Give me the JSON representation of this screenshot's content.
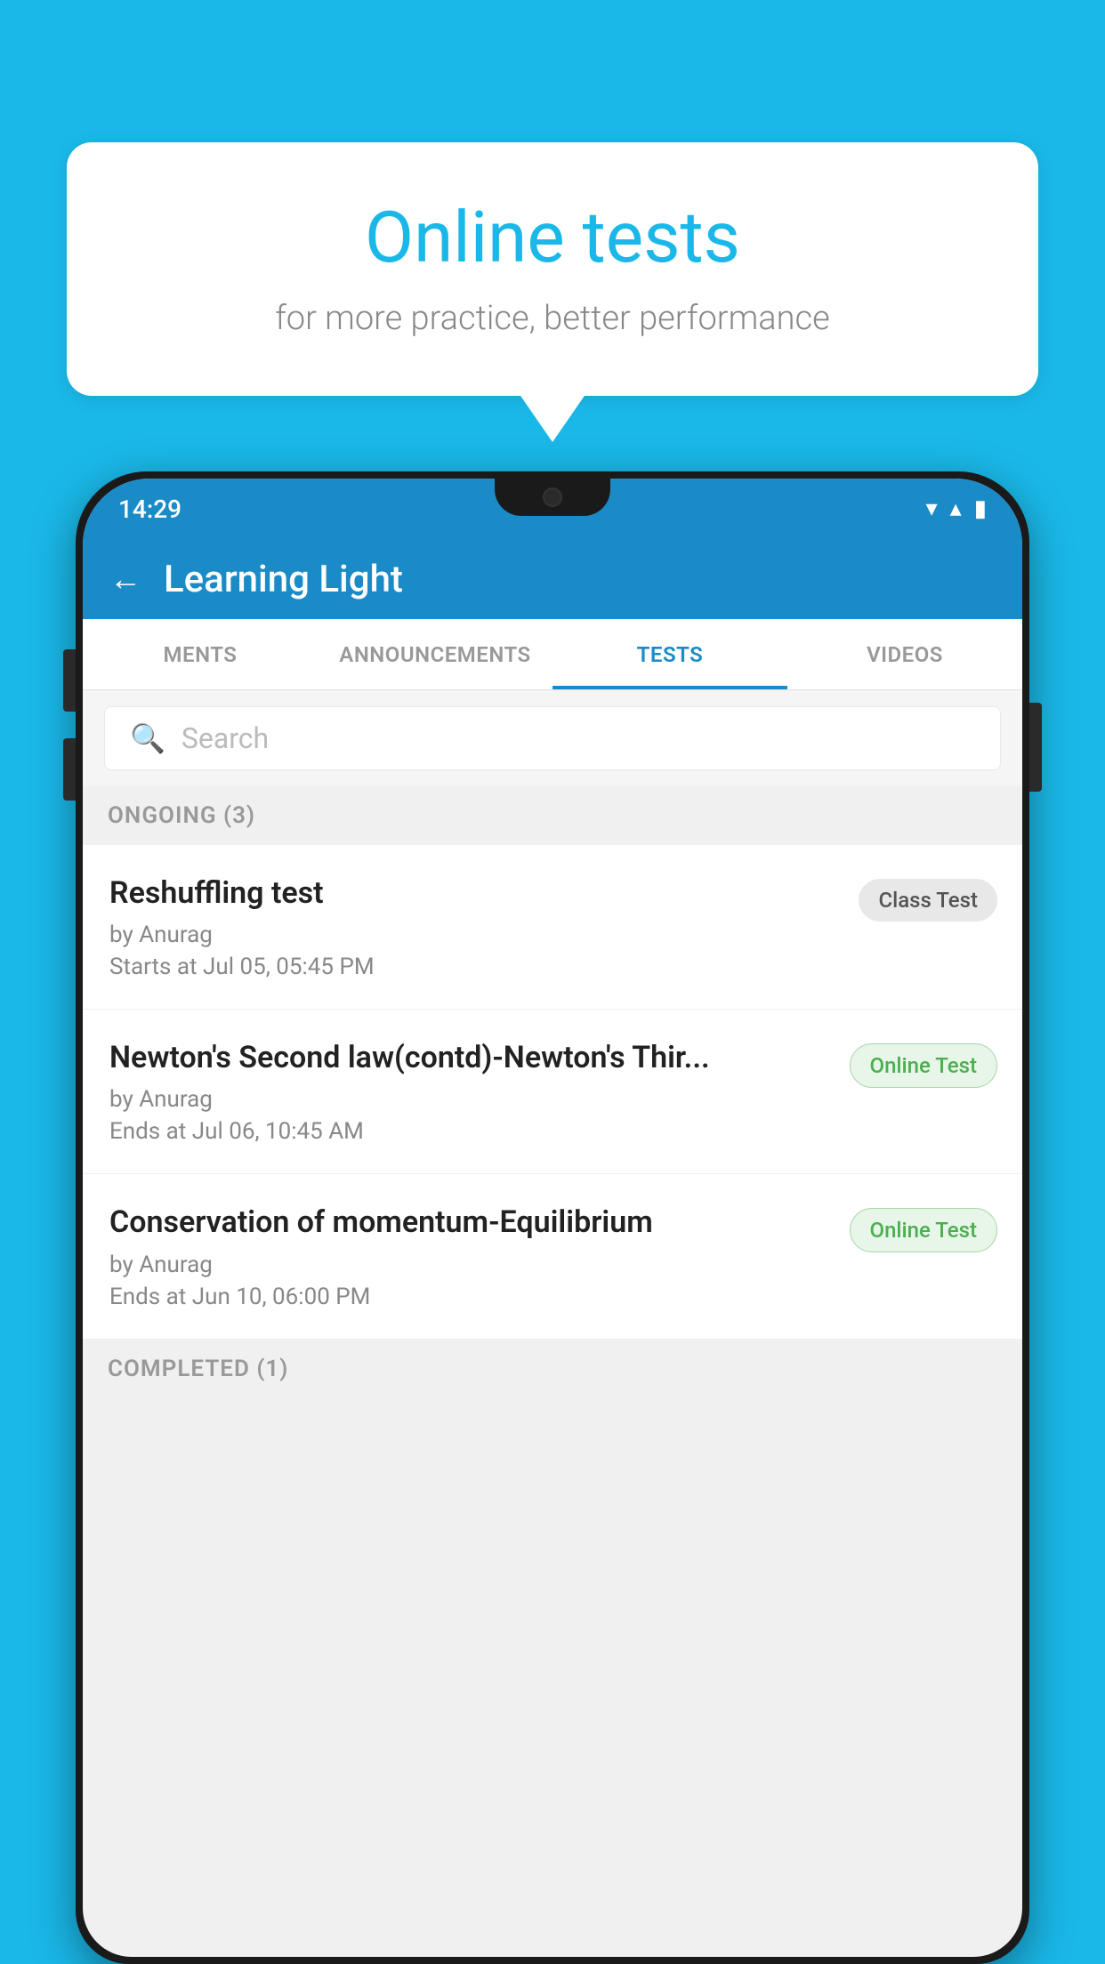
{
  "background": {
    "color": "#1ab8e8"
  },
  "speech_bubble": {
    "title": "Online tests",
    "subtitle": "for more practice, better performance"
  },
  "status_bar": {
    "time": "14:29",
    "wifi_icon": "▼",
    "signal_icon": "▲",
    "battery_icon": "▮"
  },
  "app_header": {
    "back_label": "←",
    "title": "Learning Light"
  },
  "tabs": [
    {
      "label": "MENTS",
      "active": false
    },
    {
      "label": "ANNOUNCEMENTS",
      "active": false
    },
    {
      "label": "TESTS",
      "active": true
    },
    {
      "label": "VIDEOS",
      "active": false
    }
  ],
  "search": {
    "placeholder": "Search"
  },
  "ongoing_section": {
    "label": "ONGOING (3)"
  },
  "tests": [
    {
      "name": "Reshuffling test",
      "author": "by Anurag",
      "time_label": "Starts at",
      "time": "Jul 05, 05:45 PM",
      "badge": "Class Test",
      "badge_type": "class"
    },
    {
      "name": "Newton's Second law(contd)-Newton's Thir...",
      "author": "by Anurag",
      "time_label": "Ends at",
      "time": "Jul 06, 10:45 AM",
      "badge": "Online Test",
      "badge_type": "online"
    },
    {
      "name": "Conservation of momentum-Equilibrium",
      "author": "by Anurag",
      "time_label": "Ends at",
      "time": "Jun 10, 06:00 PM",
      "badge": "Online Test",
      "badge_type": "online"
    }
  ],
  "completed_section": {
    "label": "COMPLETED (1)"
  }
}
